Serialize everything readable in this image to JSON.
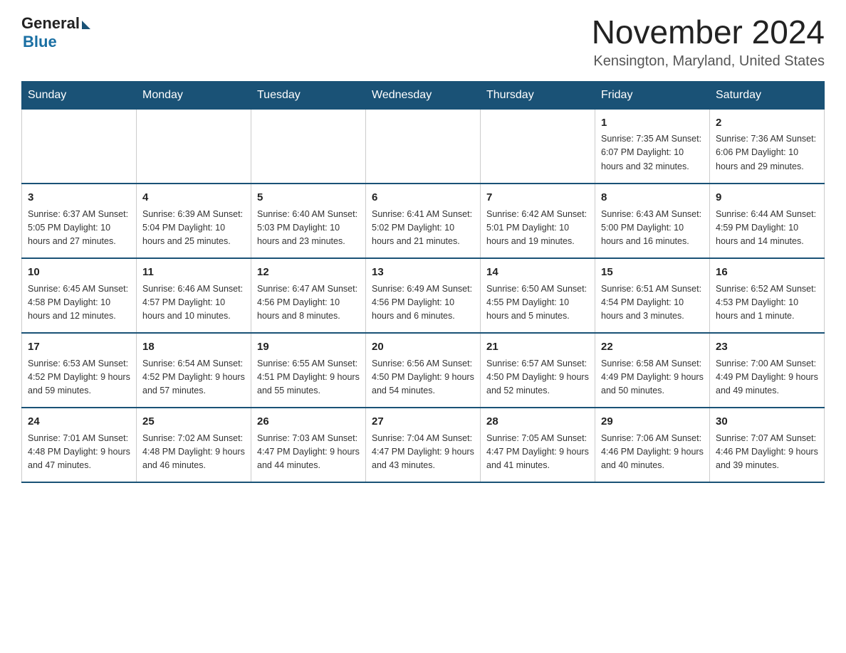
{
  "logo": {
    "general": "General",
    "blue": "Blue"
  },
  "title": "November 2024",
  "location": "Kensington, Maryland, United States",
  "weekdays": [
    "Sunday",
    "Monday",
    "Tuesday",
    "Wednesday",
    "Thursday",
    "Friday",
    "Saturday"
  ],
  "weeks": [
    [
      {
        "day": "",
        "info": ""
      },
      {
        "day": "",
        "info": ""
      },
      {
        "day": "",
        "info": ""
      },
      {
        "day": "",
        "info": ""
      },
      {
        "day": "",
        "info": ""
      },
      {
        "day": "1",
        "info": "Sunrise: 7:35 AM\nSunset: 6:07 PM\nDaylight: 10 hours\nand 32 minutes."
      },
      {
        "day": "2",
        "info": "Sunrise: 7:36 AM\nSunset: 6:06 PM\nDaylight: 10 hours\nand 29 minutes."
      }
    ],
    [
      {
        "day": "3",
        "info": "Sunrise: 6:37 AM\nSunset: 5:05 PM\nDaylight: 10 hours\nand 27 minutes."
      },
      {
        "day": "4",
        "info": "Sunrise: 6:39 AM\nSunset: 5:04 PM\nDaylight: 10 hours\nand 25 minutes."
      },
      {
        "day": "5",
        "info": "Sunrise: 6:40 AM\nSunset: 5:03 PM\nDaylight: 10 hours\nand 23 minutes."
      },
      {
        "day": "6",
        "info": "Sunrise: 6:41 AM\nSunset: 5:02 PM\nDaylight: 10 hours\nand 21 minutes."
      },
      {
        "day": "7",
        "info": "Sunrise: 6:42 AM\nSunset: 5:01 PM\nDaylight: 10 hours\nand 19 minutes."
      },
      {
        "day": "8",
        "info": "Sunrise: 6:43 AM\nSunset: 5:00 PM\nDaylight: 10 hours\nand 16 minutes."
      },
      {
        "day": "9",
        "info": "Sunrise: 6:44 AM\nSunset: 4:59 PM\nDaylight: 10 hours\nand 14 minutes."
      }
    ],
    [
      {
        "day": "10",
        "info": "Sunrise: 6:45 AM\nSunset: 4:58 PM\nDaylight: 10 hours\nand 12 minutes."
      },
      {
        "day": "11",
        "info": "Sunrise: 6:46 AM\nSunset: 4:57 PM\nDaylight: 10 hours\nand 10 minutes."
      },
      {
        "day": "12",
        "info": "Sunrise: 6:47 AM\nSunset: 4:56 PM\nDaylight: 10 hours\nand 8 minutes."
      },
      {
        "day": "13",
        "info": "Sunrise: 6:49 AM\nSunset: 4:56 PM\nDaylight: 10 hours\nand 6 minutes."
      },
      {
        "day": "14",
        "info": "Sunrise: 6:50 AM\nSunset: 4:55 PM\nDaylight: 10 hours\nand 5 minutes."
      },
      {
        "day": "15",
        "info": "Sunrise: 6:51 AM\nSunset: 4:54 PM\nDaylight: 10 hours\nand 3 minutes."
      },
      {
        "day": "16",
        "info": "Sunrise: 6:52 AM\nSunset: 4:53 PM\nDaylight: 10 hours\nand 1 minute."
      }
    ],
    [
      {
        "day": "17",
        "info": "Sunrise: 6:53 AM\nSunset: 4:52 PM\nDaylight: 9 hours\nand 59 minutes."
      },
      {
        "day": "18",
        "info": "Sunrise: 6:54 AM\nSunset: 4:52 PM\nDaylight: 9 hours\nand 57 minutes."
      },
      {
        "day": "19",
        "info": "Sunrise: 6:55 AM\nSunset: 4:51 PM\nDaylight: 9 hours\nand 55 minutes."
      },
      {
        "day": "20",
        "info": "Sunrise: 6:56 AM\nSunset: 4:50 PM\nDaylight: 9 hours\nand 54 minutes."
      },
      {
        "day": "21",
        "info": "Sunrise: 6:57 AM\nSunset: 4:50 PM\nDaylight: 9 hours\nand 52 minutes."
      },
      {
        "day": "22",
        "info": "Sunrise: 6:58 AM\nSunset: 4:49 PM\nDaylight: 9 hours\nand 50 minutes."
      },
      {
        "day": "23",
        "info": "Sunrise: 7:00 AM\nSunset: 4:49 PM\nDaylight: 9 hours\nand 49 minutes."
      }
    ],
    [
      {
        "day": "24",
        "info": "Sunrise: 7:01 AM\nSunset: 4:48 PM\nDaylight: 9 hours\nand 47 minutes."
      },
      {
        "day": "25",
        "info": "Sunrise: 7:02 AM\nSunset: 4:48 PM\nDaylight: 9 hours\nand 46 minutes."
      },
      {
        "day": "26",
        "info": "Sunrise: 7:03 AM\nSunset: 4:47 PM\nDaylight: 9 hours\nand 44 minutes."
      },
      {
        "day": "27",
        "info": "Sunrise: 7:04 AM\nSunset: 4:47 PM\nDaylight: 9 hours\nand 43 minutes."
      },
      {
        "day": "28",
        "info": "Sunrise: 7:05 AM\nSunset: 4:47 PM\nDaylight: 9 hours\nand 41 minutes."
      },
      {
        "day": "29",
        "info": "Sunrise: 7:06 AM\nSunset: 4:46 PM\nDaylight: 9 hours\nand 40 minutes."
      },
      {
        "day": "30",
        "info": "Sunrise: 7:07 AM\nSunset: 4:46 PM\nDaylight: 9 hours\nand 39 minutes."
      }
    ]
  ]
}
